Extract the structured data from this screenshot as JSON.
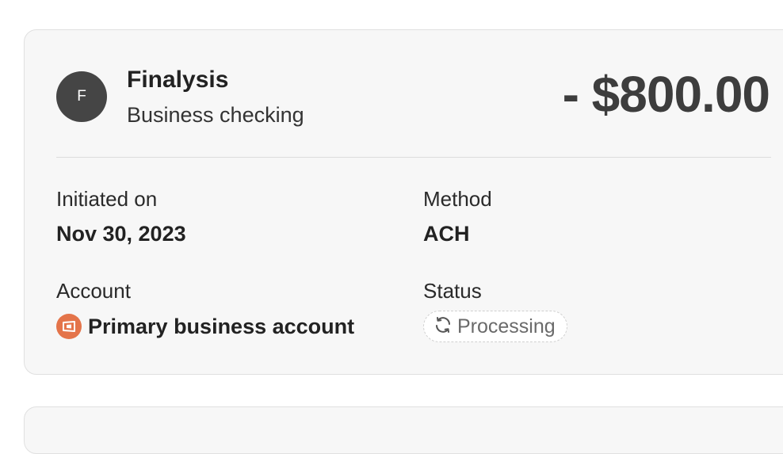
{
  "transaction": {
    "avatar_initial": "F",
    "merchant": "Finalysis",
    "account_type": "Business checking",
    "amount": "- $800.00",
    "initiated_label": "Initiated on",
    "initiated_value": "Nov 30, 2023",
    "method_label": "Method",
    "method_value": "ACH",
    "account_label": "Account",
    "account_value": "Primary business account",
    "account_icon": "bank-logo-icon",
    "status_label": "Status",
    "status_value": "Processing",
    "status_icon": "refresh-icon"
  },
  "colors": {
    "card_bg": "#f7f7f7",
    "avatar_bg": "#454545",
    "bank_icon_bg": "#e4744a",
    "status_text": "#6a6a6a"
  }
}
